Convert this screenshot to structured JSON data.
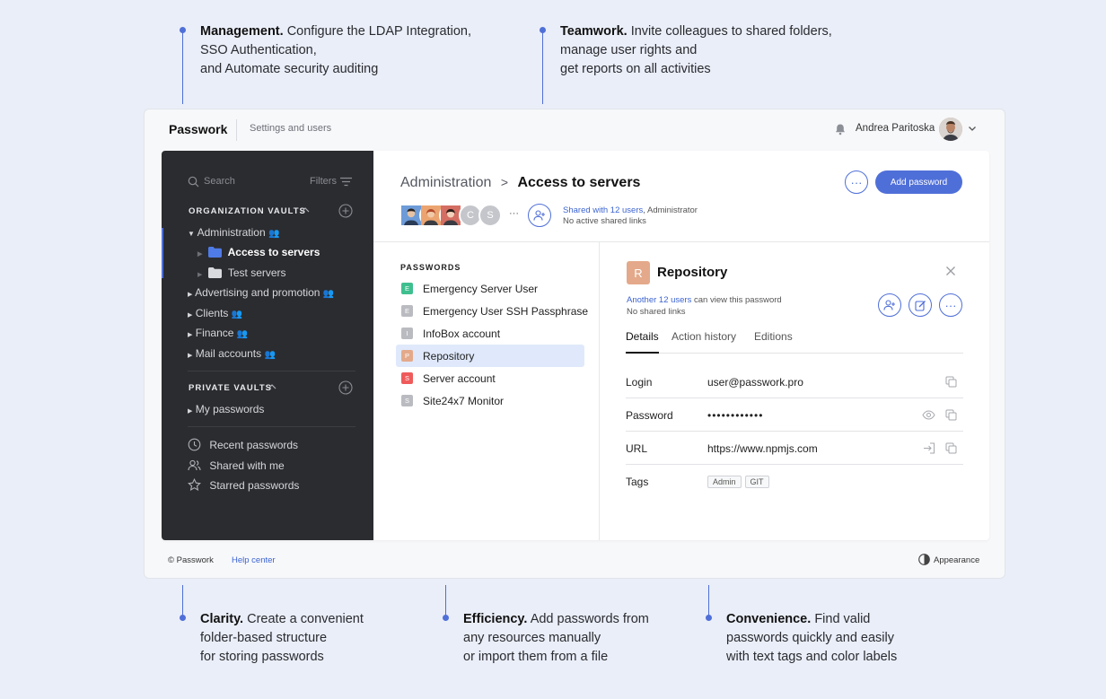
{
  "features_top": [
    {
      "title": "Management.",
      "lines": [
        "Configure the LDAP Integration,",
        "SSO Authentication,",
        "and Automate security auditing"
      ]
    },
    {
      "title": "Teamwork.",
      "lines": [
        "Invite colleagues to shared folders,",
        "manage user rights and",
        "get reports on all activities"
      ]
    }
  ],
  "features_bottom": [
    {
      "title": "Clarity.",
      "lines": [
        "Create a convenient",
        "folder-based structure",
        "for storing passwords"
      ]
    },
    {
      "title": "Efficiency.",
      "lines": [
        "Add passwords from",
        "any resources manually",
        "or import them from a file"
      ]
    },
    {
      "title": "Convenience.",
      "lines": [
        "Find valid",
        "passwords quickly and easily",
        "with text tags and color labels"
      ]
    }
  ],
  "topbar": {
    "brand": "Passwork",
    "section": "Settings and users",
    "user_name": "Andrea Paritoska"
  },
  "sidebar": {
    "search_placeholder": "Search",
    "filters_label": "Filters",
    "org_vaults_label": "ORGANIZATION VAULTS",
    "org_items": [
      "Administration",
      "Advertising and promotion",
      "Clients",
      "Finance",
      "Mail accounts"
    ],
    "admin_folders": [
      "Access to servers",
      "Test servers"
    ],
    "private_vaults_label": "PRIVATE VAULTS",
    "private_items": [
      "My passwords"
    ],
    "bottom_links": [
      "Recent passwords",
      "Shared with me",
      "Starred passwords"
    ]
  },
  "main": {
    "crumb_parent": "Administration",
    "crumb_separator": ">",
    "crumb_current": "Access to servers",
    "add_password_label": "Add password",
    "more_dots": "···",
    "avatar_letters": [
      "C",
      "S"
    ],
    "shared_link": "Shared with 12 users",
    "shared_role": ", Administrator",
    "shared_links_status": "No active shared links"
  },
  "passwords": {
    "title": "PASSWORDS",
    "items": [
      {
        "letter": "E",
        "name": "Emergency Server User",
        "color": "#3fbf8f"
      },
      {
        "letter": "E",
        "name": "Emergency User SSH Passphrase",
        "color": "#b9bbc0"
      },
      {
        "letter": "I",
        "name": "InfoBox account",
        "color": "#b9bbc0"
      },
      {
        "letter": "P",
        "name": "Repository",
        "color": "#e4a98a"
      },
      {
        "letter": "S",
        "name": "Server account",
        "color": "#ef5b5b"
      },
      {
        "letter": "S",
        "name": "Site24x7 Monitor",
        "color": "#b9bbc0"
      }
    ],
    "selected_index": 3
  },
  "detail": {
    "icon_letter": "R",
    "title": "Repository",
    "viewers_link": "Another 12 users",
    "viewers_text": " can view this password",
    "shared_links": "No shared links",
    "tabs": [
      "Details",
      "Action history",
      "Editions"
    ],
    "fields": {
      "login_label": "Login",
      "login_value": "user@passwork.pro",
      "password_label": "Password",
      "password_value": "••••••••••••",
      "url_label": "URL",
      "url_value": "https://www.npmjs.com",
      "tags_label": "Tags",
      "tags": [
        "Admin",
        "GIT"
      ]
    }
  },
  "footer": {
    "copyright": "© Passwork",
    "help": "Help center",
    "appearance": "Appearance"
  },
  "colors": {
    "accent": "#4f6fd8",
    "sidebar_bg": "#2b2c30",
    "page_bg": "#eaeef8",
    "selected_row": "#dfe9fb"
  }
}
